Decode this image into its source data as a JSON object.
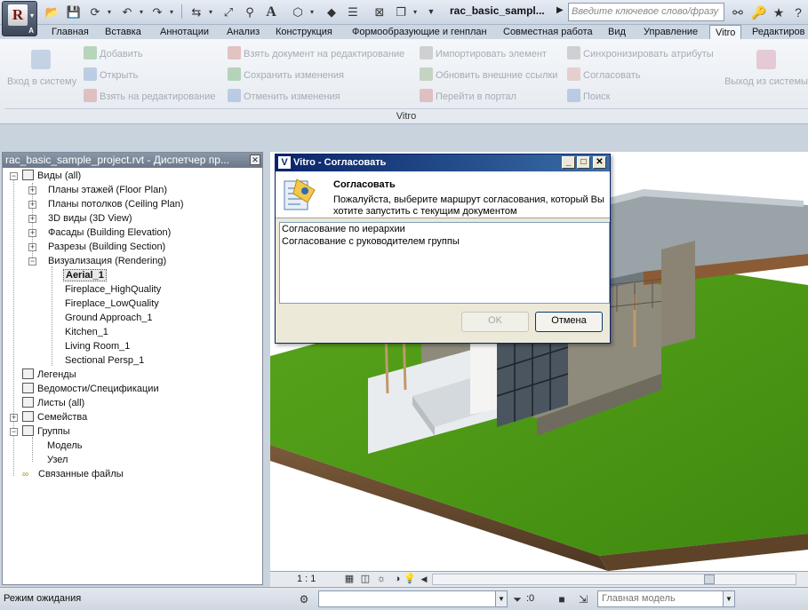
{
  "app": {
    "document_title": "rac_basic_sampl...",
    "search_placeholder": "Введите ключевое слово/фразу",
    "app_letter": "R",
    "app_suffix": "A"
  },
  "tabs": [
    "Главная",
    "Вставка",
    "Аннотации",
    "Анализ",
    "Конструкция",
    "Формообразующие и генплан",
    "Совместная работа",
    "Вид",
    "Управление",
    "Vitro",
    "Редактиров"
  ],
  "active_tab": "Vitro",
  "ribbon": {
    "login": "Вход в систему",
    "col1": [
      "Добавить",
      "Открыть",
      "Взять на редактирование"
    ],
    "col2": [
      "Взять документ на редактирование",
      "Сохранить изменения",
      "Отменить изменения"
    ],
    "col3": [
      "Импортировать элемент",
      "Обновить внешние ссылки",
      "Перейти в портал"
    ],
    "col4": [
      "Синхронизировать атрибуты",
      "Согласовать",
      "Поиск"
    ],
    "logout": "Выход из системы",
    "panel_label": "Vitro"
  },
  "browser": {
    "title": "rac_basic_sample_project.rvt - Диспетчер пр...",
    "close_symbol": "✕",
    "views_root": "Виды (all)",
    "view_groups": [
      "Планы этажей (Floor Plan)",
      "Планы потолков (Ceiling Plan)",
      "3D виды (3D View)",
      "Фасады (Building Elevation)",
      "Разрезы (Building Section)",
      "Визуализация (Rendering)"
    ],
    "renderings": [
      "Aerial_1",
      "Fireplace_HighQuality",
      "Fireplace_LowQuality",
      "Ground Approach_1",
      "Kitchen_1",
      "Living Room_1",
      "Sectional Persp_1"
    ],
    "legends": "Легенды",
    "schedules": "Ведомости/Спецификации",
    "sheets": "Листы (all)",
    "families": "Семейства",
    "groups": "Группы",
    "group_children": [
      "Модель",
      "Узел"
    ],
    "linked": "Связанные файлы"
  },
  "dialog": {
    "title": "Vitro - Согласовать",
    "app_icon_letter": "V",
    "header_title": "Согласовать",
    "header_text": "Пожалуйста, выберите маршрут согласования, который Вы хотите запустить с текущим документом",
    "routes": [
      "Согласование по иерархии",
      "Согласование с руководителем группы"
    ],
    "ok": "OK",
    "cancel": "Отмена",
    "minimize": "_",
    "maximize": "□",
    "close": "✕"
  },
  "view_control": {
    "scale": "1 : 1"
  },
  "status": {
    "text": "Режим ожидания",
    "selection_count": ":0",
    "model": "Главная модель"
  }
}
